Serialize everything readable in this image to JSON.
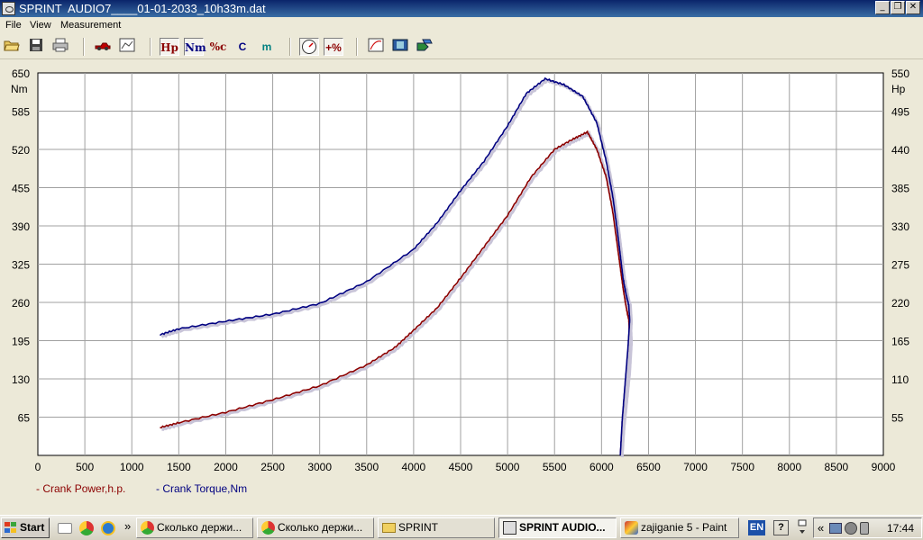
{
  "window": {
    "title": "SPRINT  AUDIO7____01-01-2033_10h33m.dat",
    "minimize_glyph": "_",
    "restore_glyph": "❐",
    "close_glyph": "✕"
  },
  "menu": [
    "File",
    "View",
    "Measurement"
  ],
  "toolbar": {
    "hp_label": "Hp",
    "nm_label": "Nm",
    "pct_label": "%c",
    "c_label": "C",
    "m_label": "m",
    "plus_pct_label": "+%"
  },
  "chart_data": {
    "type": "line",
    "xlabel": "",
    "x_ticks": [
      0,
      500,
      1000,
      1500,
      2000,
      2500,
      3000,
      3500,
      4000,
      4500,
      5000,
      5500,
      6000,
      6500,
      7000,
      7500,
      8000,
      8500,
      9000
    ],
    "xlim": [
      0,
      9000
    ],
    "y_left": {
      "unit": "Nm",
      "ticks": [
        65,
        130,
        195,
        260,
        325,
        390,
        455,
        520,
        585,
        650
      ],
      "lim": [
        0,
        650
      ]
    },
    "y_right": {
      "unit": "Hp",
      "ticks": [
        55,
        110,
        165,
        220,
        275,
        330,
        385,
        440,
        495,
        550
      ],
      "lim": [
        0,
        550
      ]
    },
    "grid": true,
    "legend_position": "bottom-left",
    "series": [
      {
        "name": "Crank Power,h.p.",
        "axis": "right",
        "color": "#8b0000",
        "points": [
          [
            1300,
            40
          ],
          [
            1500,
            47
          ],
          [
            2000,
            62
          ],
          [
            2500,
            80
          ],
          [
            3000,
            100
          ],
          [
            3500,
            130
          ],
          [
            3800,
            155
          ],
          [
            4000,
            180
          ],
          [
            4250,
            212
          ],
          [
            4500,
            255
          ],
          [
            4750,
            300
          ],
          [
            5000,
            345
          ],
          [
            5250,
            400
          ],
          [
            5500,
            440
          ],
          [
            5700,
            455
          ],
          [
            5850,
            465
          ],
          [
            5950,
            440
          ],
          [
            6050,
            400
          ],
          [
            6120,
            350
          ],
          [
            6170,
            300
          ],
          [
            6200,
            270
          ],
          [
            6230,
            240
          ],
          [
            6260,
            215
          ],
          [
            6290,
            195
          ],
          [
            6300,
            165
          ],
          [
            6280,
            120
          ],
          [
            6250,
            80
          ],
          [
            6220,
            40
          ],
          [
            6200,
            0
          ]
        ]
      },
      {
        "name": "Crank Torque,Nm",
        "axis": "left",
        "color": "#000080",
        "points": [
          [
            1300,
            205
          ],
          [
            1500,
            215
          ],
          [
            2000,
            228
          ],
          [
            2500,
            240
          ],
          [
            3000,
            258
          ],
          [
            3500,
            295
          ],
          [
            4000,
            350
          ],
          [
            4250,
            395
          ],
          [
            4500,
            450
          ],
          [
            4750,
            500
          ],
          [
            5000,
            560
          ],
          [
            5200,
            615
          ],
          [
            5400,
            640
          ],
          [
            5600,
            630
          ],
          [
            5800,
            610
          ],
          [
            5950,
            565
          ],
          [
            6050,
            500
          ],
          [
            6120,
            440
          ],
          [
            6170,
            380
          ],
          [
            6200,
            340
          ],
          [
            6230,
            300
          ],
          [
            6260,
            275
          ],
          [
            6290,
            255
          ],
          [
            6300,
            230
          ],
          [
            6280,
            180
          ],
          [
            6250,
            120
          ],
          [
            6220,
            60
          ],
          [
            6200,
            0
          ]
        ]
      }
    ]
  },
  "taskbar": {
    "start_label": "Start",
    "more_glyph": "»",
    "tasks": [
      "Сколько держи...",
      "Сколько держи...",
      "SPRINT",
      "SPRINT  AUDIO...",
      "zajiganie 5 - Paint"
    ],
    "lang": "EN",
    "help_glyph": "?",
    "tray_arrow": "«",
    "clock": "17:44"
  }
}
